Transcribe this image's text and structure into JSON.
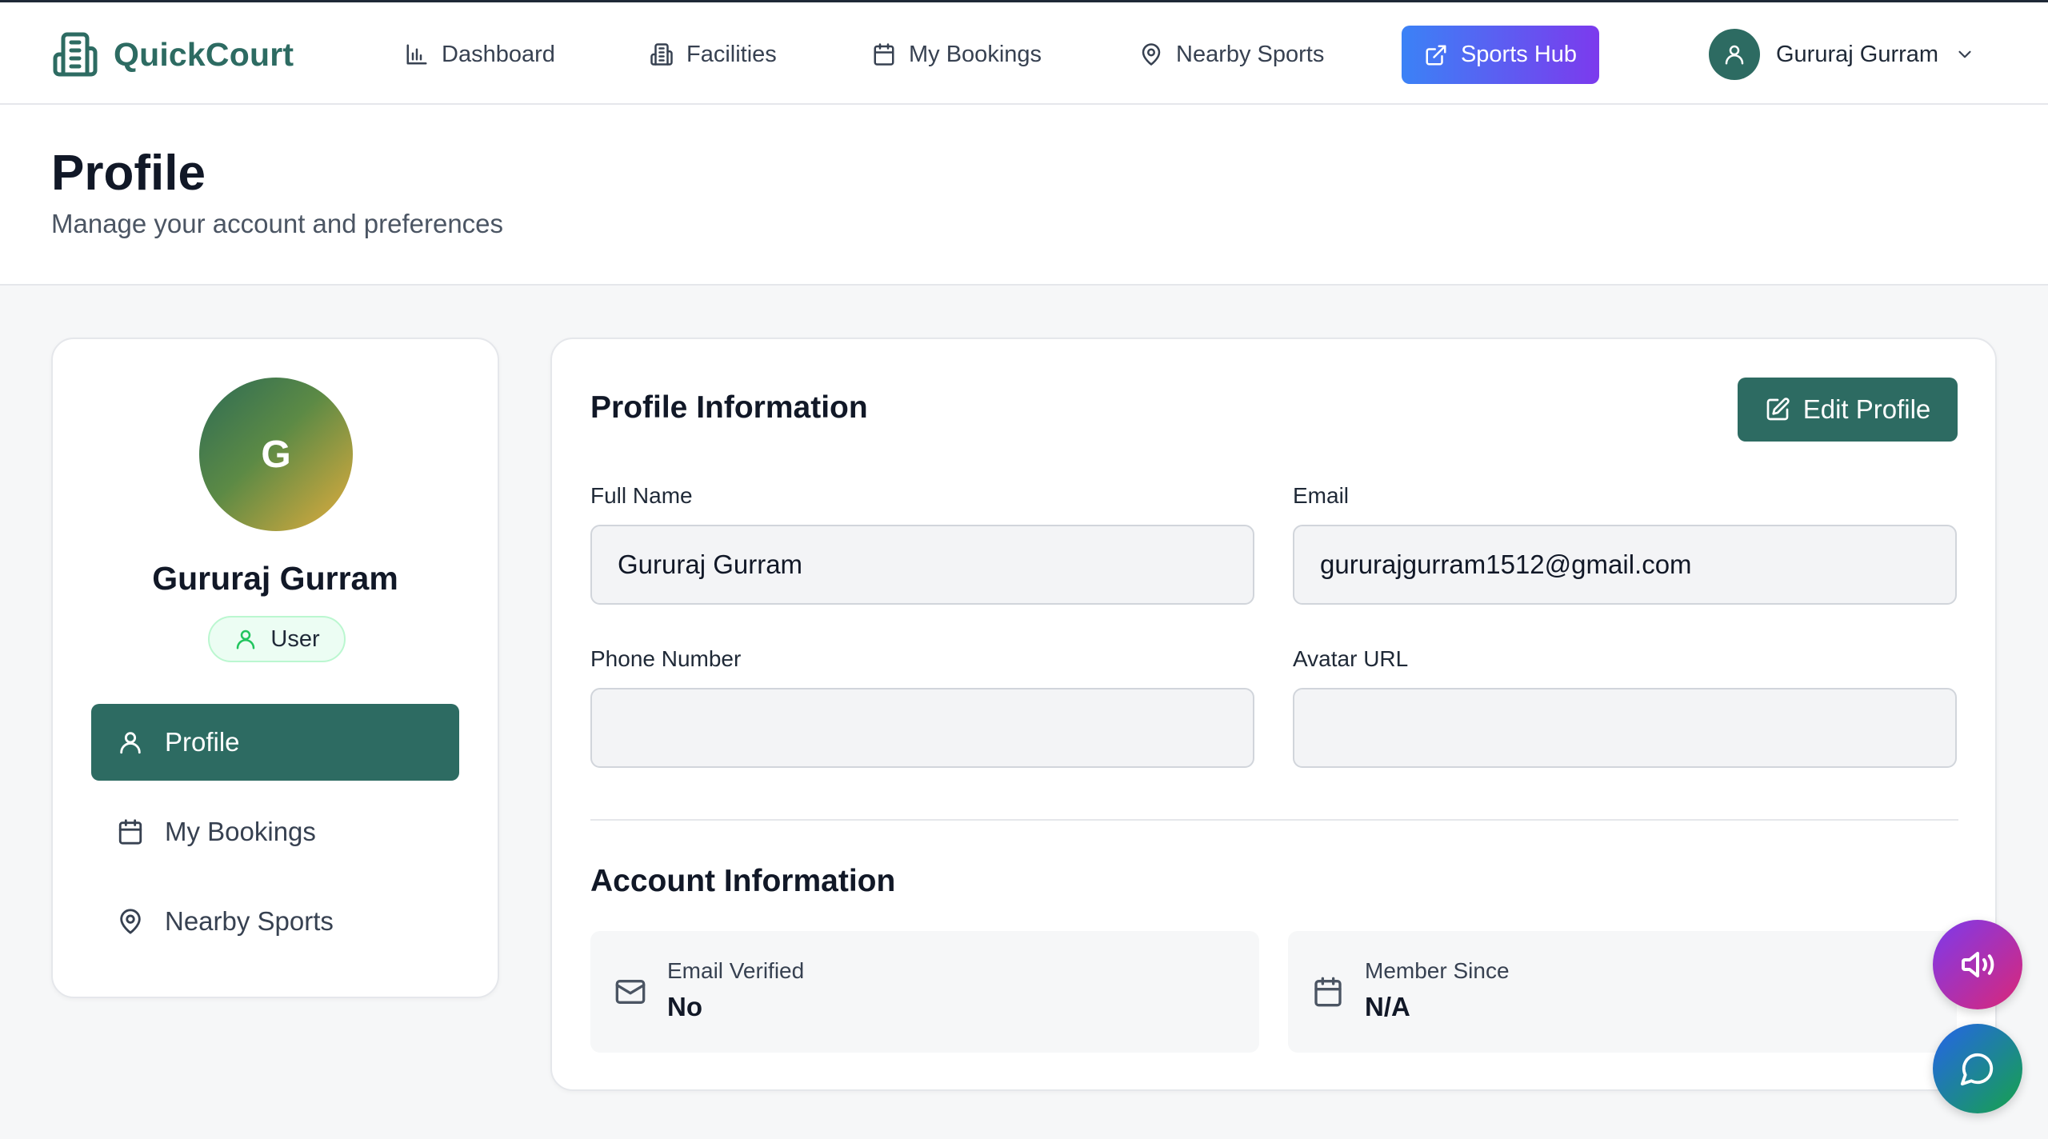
{
  "colors": {
    "brand": "#2d6b62",
    "sports_hub_gradient": [
      "#3b82f6",
      "#7c3aed"
    ],
    "page_background": "#f6f7f8"
  },
  "nav": {
    "brand": "QuickCourt",
    "items": [
      {
        "label": "Dashboard",
        "icon": "bar-chart-icon"
      },
      {
        "label": "Facilities",
        "icon": "building-icon"
      },
      {
        "label": "My Bookings",
        "icon": "calendar-icon"
      },
      {
        "label": "Nearby Sports",
        "icon": "map-pin-icon"
      }
    ],
    "sports_hub": {
      "label": "Sports Hub",
      "icon": "external-link-icon"
    },
    "user_name": "Gururaj Gurram"
  },
  "header": {
    "title": "Profile",
    "subtitle": "Manage your account and preferences"
  },
  "sidebar": {
    "avatar_initial": "G",
    "name": "Gururaj Gurram",
    "role": "User",
    "items": [
      {
        "label": "Profile",
        "icon": "user-icon",
        "active": true
      },
      {
        "label": "My Bookings",
        "icon": "calendar-icon",
        "active": false
      },
      {
        "label": "Nearby Sports",
        "icon": "map-pin-icon",
        "active": false
      }
    ]
  },
  "profile": {
    "title": "Profile Information",
    "edit_label": "Edit Profile",
    "fields": {
      "full_name": {
        "label": "Full Name",
        "value": "Gururaj Gurram"
      },
      "email": {
        "label": "Email",
        "value": "gururajgurram1512@gmail.com"
      },
      "phone": {
        "label": "Phone Number",
        "value": ""
      },
      "avatar_url": {
        "label": "Avatar URL",
        "value": ""
      }
    }
  },
  "account": {
    "title": "Account Information",
    "email_verified": {
      "label": "Email Verified",
      "value": "No",
      "icon": "mail-icon"
    },
    "member_since": {
      "label": "Member Since",
      "value": "N/A",
      "icon": "calendar-icon"
    }
  }
}
